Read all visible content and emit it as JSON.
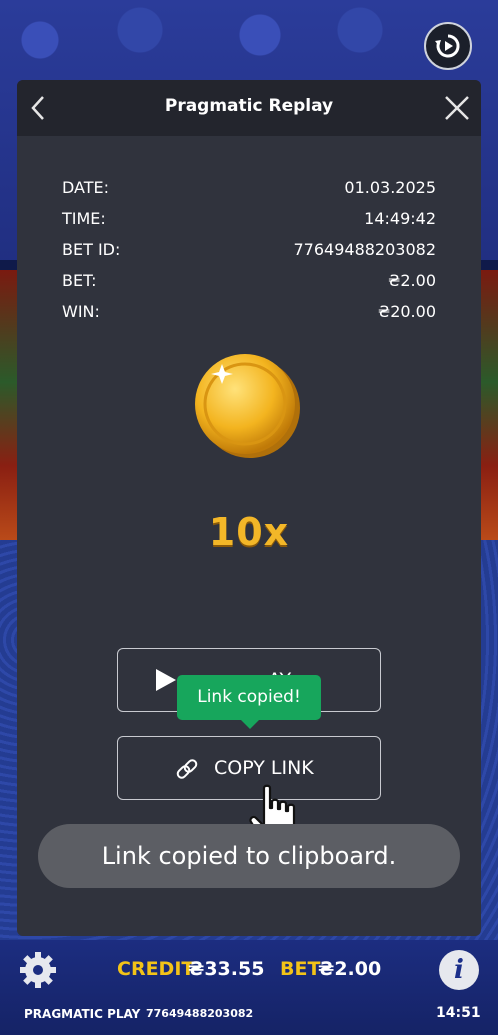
{
  "modal": {
    "title": "Pragmatic Replay",
    "info": [
      {
        "label": "DATE:",
        "value": "01.03.2025"
      },
      {
        "label": "TIME:",
        "value": "14:49:42"
      },
      {
        "label": "BET ID:",
        "value": "77649488203082"
      },
      {
        "label": "BET:",
        "value": "₴2.00"
      },
      {
        "label": "WIN:",
        "value": "₴20.00"
      }
    ],
    "multiplier": "10x",
    "play_label": "AY",
    "copy_link_label": "COPY LINK",
    "tooltip": "Link copied!"
  },
  "toast": "Link copied to clipboard.",
  "footer": {
    "credit_label": "CREDIT",
    "credit_value": "₴33.55",
    "bet_label": "BET",
    "bet_value": "₴2.00",
    "brand": "PRAGMATIC PLAY",
    "bet_id": "77649488203082",
    "time": "14:51"
  },
  "colors": {
    "modal_bg": "#30333d",
    "header_bg": "#23252d",
    "accent_gold": "#f3b728",
    "tooltip_green": "#17a65c"
  },
  "icons": [
    "replay-icon",
    "back-icon",
    "close-icon",
    "coin-icon",
    "play-icon",
    "link-icon",
    "hand-cursor-icon",
    "gear-icon",
    "info-icon"
  ]
}
